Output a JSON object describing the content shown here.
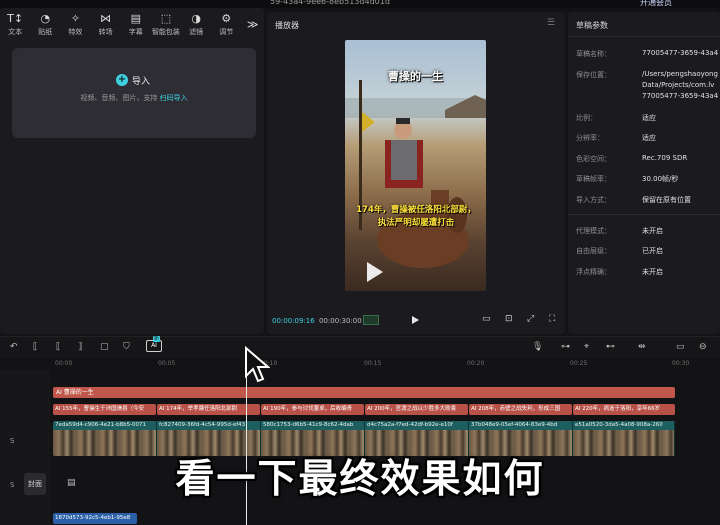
{
  "topbar": {
    "project_id": "59-43a4-9ee6-8eb513d4d01d",
    "account": "开通会员"
  },
  "media_toolbar": {
    "tools": [
      {
        "label": "文本",
        "icon": "text-icon"
      },
      {
        "label": "贴纸",
        "icon": "sticker-icon"
      },
      {
        "label": "特效",
        "icon": "effects-icon"
      },
      {
        "label": "转场",
        "icon": "transition-icon"
      },
      {
        "label": "字幕",
        "icon": "subtitle-icon"
      },
      {
        "label": "智能包装",
        "icon": "smart-package-icon"
      },
      {
        "label": "滤镜",
        "icon": "filter-icon"
      },
      {
        "label": "调节",
        "icon": "adjust-icon"
      }
    ],
    "more": "≫"
  },
  "import": {
    "title": "导入",
    "hint_prefix": "视频、音频、图片，支持",
    "hint_link": "扫码导入"
  },
  "player": {
    "title": "播放器",
    "video_title": "曹操的一生",
    "subtitle": "174年，曹操被任洛阳北部尉，执法严明却屡遭打击",
    "current_time": "00:00:09:16",
    "total_time": "00:00:30:00"
  },
  "properties": {
    "title": "草稿参数",
    "rows": [
      {
        "label": "草稿名称：",
        "value": "77005477-3659-43a4"
      },
      {
        "label": "保存位置：",
        "value": "/Users/pengshaoyong"
      },
      {
        "label": "",
        "value": "Data/Projects/com.lv"
      },
      {
        "label": "",
        "value": "77005477-3659-43a4"
      },
      {
        "label": "比例：",
        "value": "适应"
      },
      {
        "label": "分辨率：",
        "value": "适应"
      },
      {
        "label": "色彩空间：",
        "value": "Rec.709 SDR"
      },
      {
        "label": "草稿帧率：",
        "value": "30.00帧/秒"
      },
      {
        "label": "导入方式：",
        "value": "保留在原有位置"
      },
      {
        "label": "代理模式：",
        "value": "未开启"
      },
      {
        "label": "自由层级：",
        "value": "已开启"
      },
      {
        "label": "浮点精确：",
        "value": "未开启"
      }
    ]
  },
  "ruler": {
    "ticks": [
      "00:00",
      "00:05",
      "00:10",
      "00:15",
      "00:20",
      "00:25",
      "00:30"
    ]
  },
  "timeline": {
    "ai_badge": "AI",
    "ai_tag": "新",
    "title_track": "AI 曹操的一生",
    "subtitle_segments": [
      "AI 155年，曹操生于沛国谯县（今安",
      "AI 174年，举孝廉任洛阳北部尉",
      "AI 190年，参与讨伐董卓，后收编青",
      "AI 200年，官渡之战以少胜多大败袁",
      "AI 208年，赤壁之战失利，形成三国",
      "AI 220年，病逝于洛阳，享年66岁"
    ],
    "video_clips": [
      "7eda59d4-c906-4e21-b8b5-0071",
      "fc827409-36fd-4c54-995d-ef43",
      "580c1753-d6b5-41c9-8c62-4dab",
      "d4c75a2a-f7ed-42df-b92e-e10f",
      "37b048e9-05ef-4064-83e9-4bd",
      "e51a0520-3da5-4a08-908a-260"
    ],
    "audio_clip": "1870d573-92c5-4eb1-95e8",
    "cover_label": "封面",
    "track_labels": [
      "S",
      "S"
    ]
  },
  "overlay_caption": "看一下最终效果如何"
}
